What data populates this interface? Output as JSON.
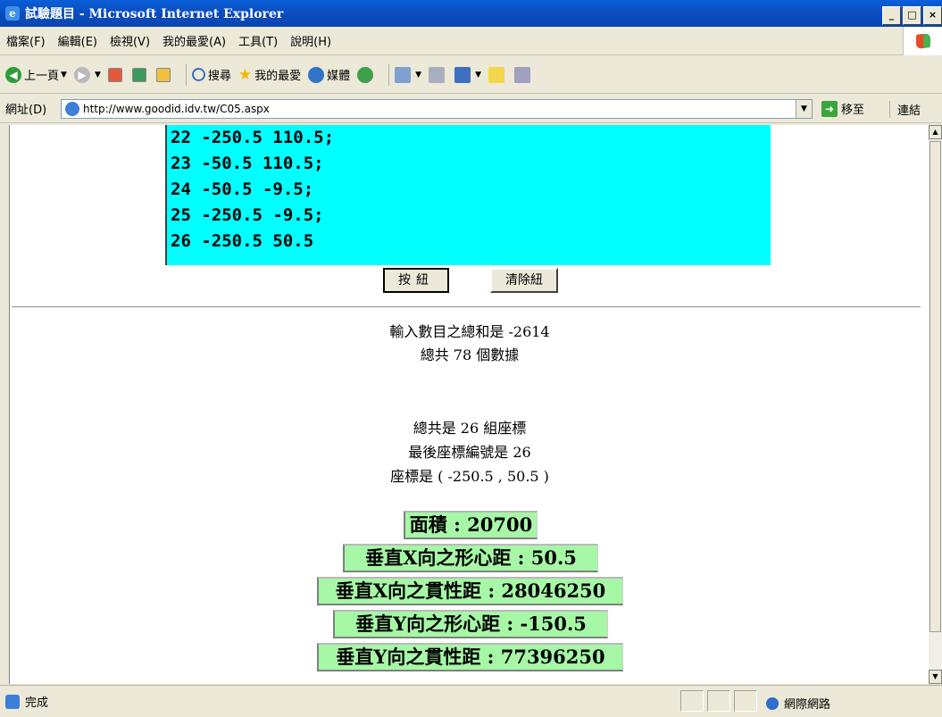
{
  "window": {
    "title": "試驗題目 - Microsoft Internet Explorer",
    "buttons": [
      "_",
      "□",
      "×"
    ]
  },
  "menu": [
    "檔案(F)",
    "編輯(E)",
    "檢視(V)",
    "我的最愛(A)",
    "工具(T)",
    "說明(H)"
  ],
  "toolbar": {
    "back": "上一頁",
    "search": "搜尋",
    "favorites": "我的最愛",
    "media": "媒體"
  },
  "address": {
    "label": "網址(D)",
    "url": "http://www.goodid.idv.tw/C05.aspx",
    "go": "移至",
    "links": "連結"
  },
  "textarea_lines": [
    "22 -250.5 110.5;",
    "23 -50.5 110.5;",
    "24 -50.5 -9.5;",
    "25 -250.5 -9.5;",
    "26 -250.5 50.5"
  ],
  "buttons": {
    "submit": "按紐",
    "clear": "清除紐"
  },
  "results": {
    "sum": "輸入數目之總和是 -2614",
    "count": "總共 78 個數據",
    "pairs": "總共是 26 組座標",
    "last_index": "最後座標編號是 26",
    "coord": "座標是 ( -250.5 , 50.5 )"
  },
  "properties": [
    "面積 : 20700",
    "垂直X向之形心距 : 50.5",
    "垂直X向之貫性距 : 28046250",
    "垂直Y向之形心距 : -150.5",
    "垂直Y向之貫性距 : 77396250"
  ],
  "status": {
    "text": "完成",
    "zone": "網際網路"
  },
  "colors": {
    "textarea_bg": "#00ffff",
    "result_bg": "#a6f7a6",
    "titlebar": "#0a52c8"
  }
}
